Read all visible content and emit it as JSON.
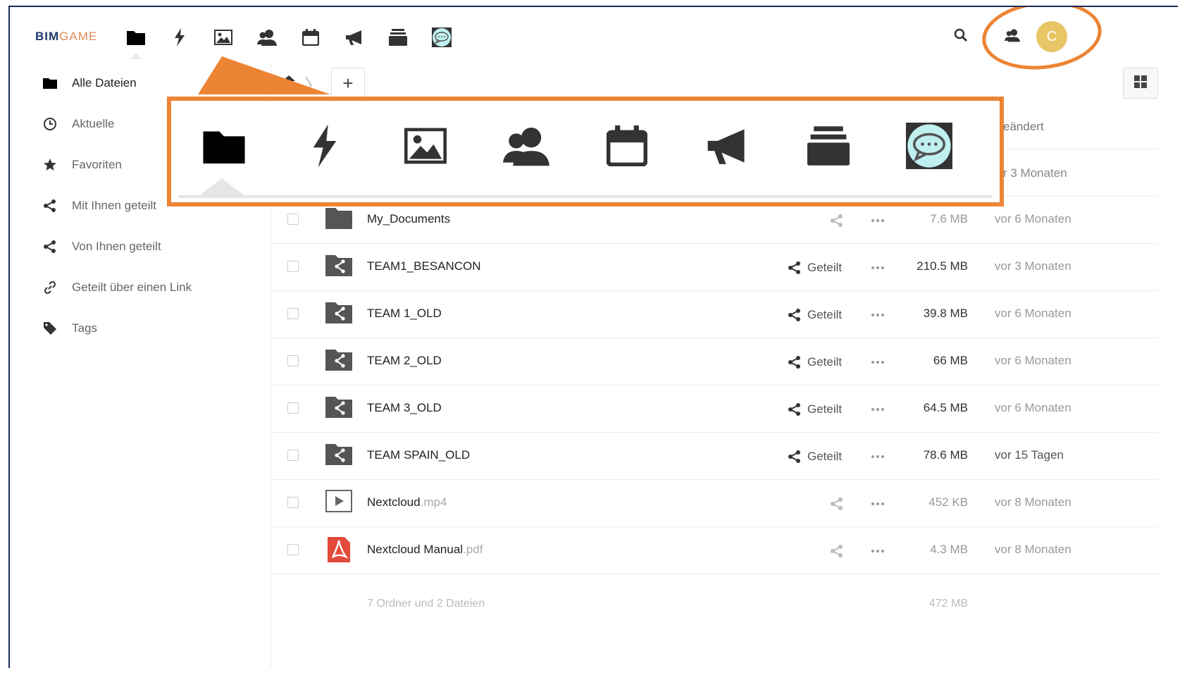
{
  "header": {
    "logo_part1": "BIM",
    "logo_part2": "GAME",
    "apps": [
      "files-icon",
      "activity-icon",
      "gallery-icon",
      "contacts-icon",
      "calendar-icon",
      "announcements-icon",
      "deck-icon",
      "talk-icon"
    ],
    "avatar_letter": "C"
  },
  "sidebar": {
    "items": [
      {
        "label": "Alle Dateien",
        "icon": "folder-icon"
      },
      {
        "label": "Aktuelle",
        "icon": "clock-icon"
      },
      {
        "label": "Favoriten",
        "icon": "star-icon"
      },
      {
        "label": "Mit Ihnen geteilt",
        "icon": "share-icon"
      },
      {
        "label": "Von Ihnen geteilt",
        "icon": "share-icon"
      },
      {
        "label": "Geteilt über einen Link",
        "icon": "link-icon"
      },
      {
        "label": "Tags",
        "icon": "tag-icon"
      }
    ]
  },
  "content": {
    "add_label": "+",
    "column_modified_fragment": "eändert",
    "first_row_date_fragment": "r 3 Monaten",
    "files": [
      {
        "name": "My_Documents",
        "ext": "",
        "type": "folder",
        "shared": false,
        "share_label": "",
        "size": "7.6 MB",
        "modified": "vor 6 Monaten"
      },
      {
        "name": "TEAM1_BESANCON",
        "ext": "",
        "type": "shared-folder",
        "shared": true,
        "share_label": "Geteilt",
        "size": "210.5 MB",
        "modified": "vor 3 Monaten"
      },
      {
        "name": "TEAM 1_OLD",
        "ext": "",
        "type": "shared-folder",
        "shared": true,
        "share_label": "Geteilt",
        "size": "39.8 MB",
        "modified": "vor 6 Monaten"
      },
      {
        "name": "TEAM 2_OLD",
        "ext": "",
        "type": "shared-folder",
        "shared": true,
        "share_label": "Geteilt",
        "size": "66 MB",
        "modified": "vor 6 Monaten"
      },
      {
        "name": "TEAM 3_OLD",
        "ext": "",
        "type": "shared-folder",
        "shared": true,
        "share_label": "Geteilt",
        "size": "64.5 MB",
        "modified": "vor 6 Monaten"
      },
      {
        "name": "TEAM SPAIN_OLD",
        "ext": "",
        "type": "shared-folder",
        "shared": true,
        "share_label": "Geteilt",
        "size": "78.6 MB",
        "modified": "vor 15 Tagen"
      },
      {
        "name": "Nextcloud",
        "ext": ".mp4",
        "type": "video",
        "shared": false,
        "share_label": "",
        "size": "452 KB",
        "modified": "vor 8 Monaten"
      },
      {
        "name": "Nextcloud Manual",
        "ext": ".pdf",
        "type": "pdf",
        "shared": false,
        "share_label": "",
        "size": "4.3 MB",
        "modified": "vor 8 Monaten"
      }
    ],
    "summary_text": "7 Ordner und 2 Dateien",
    "summary_size": "472 MB"
  },
  "colors": {
    "annotation": "#ec8434",
    "avatar": "#e8c665",
    "logo_primary": "#1d3a6b",
    "logo_secondary": "#e58a55"
  }
}
